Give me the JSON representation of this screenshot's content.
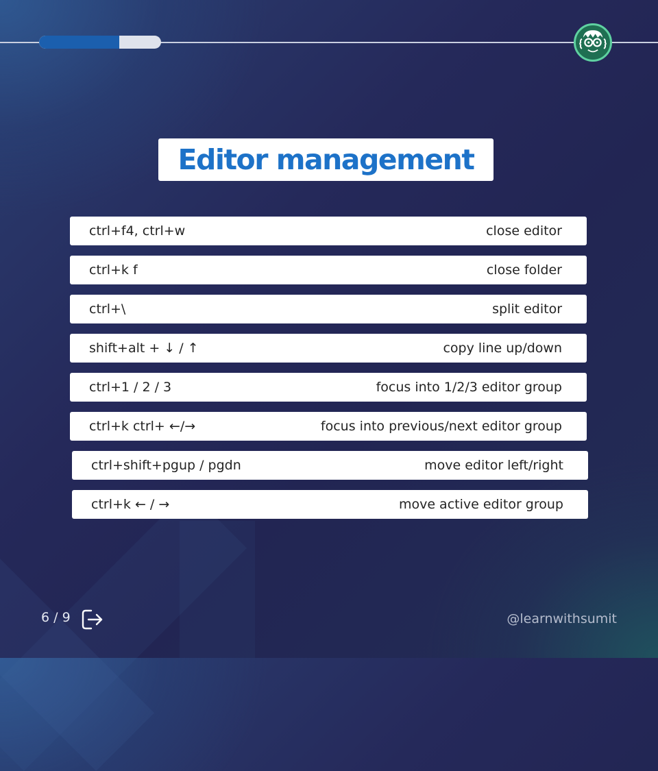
{
  "progress": {
    "fraction": 0.66
  },
  "title": "Editor management",
  "rows": [
    {
      "keys": "ctrl+f4, ctrl+w",
      "action": "close editor"
    },
    {
      "keys": "ctrl+k f",
      "action": "close folder"
    },
    {
      "keys": "ctrl+\\",
      "action": "split editor"
    },
    {
      "keys": "shift+alt + ↓ / ↑",
      "action": "copy line up/down"
    },
    {
      "keys": "ctrl+1 / 2 / 3",
      "action": "focus into 1/2/3 editor group"
    },
    {
      "keys": "ctrl+k ctrl+ ←/→",
      "action": "focus into previous/next editor group"
    },
    {
      "keys": "ctrl+shift+pgup / pgdn",
      "action": "move editor left/right"
    },
    {
      "keys": "ctrl+k ← / →",
      "action": "move active editor group"
    }
  ],
  "footer": {
    "page": "6 / 9",
    "handle": "@learnwithsumit"
  },
  "icons": {
    "logo": "avatar-logo-icon",
    "next": "exit-arrow-icon"
  },
  "colors": {
    "accent": "#1d72c8",
    "progress_fill": "#1b5fae",
    "logo_ring": "#5fd1a1"
  }
}
